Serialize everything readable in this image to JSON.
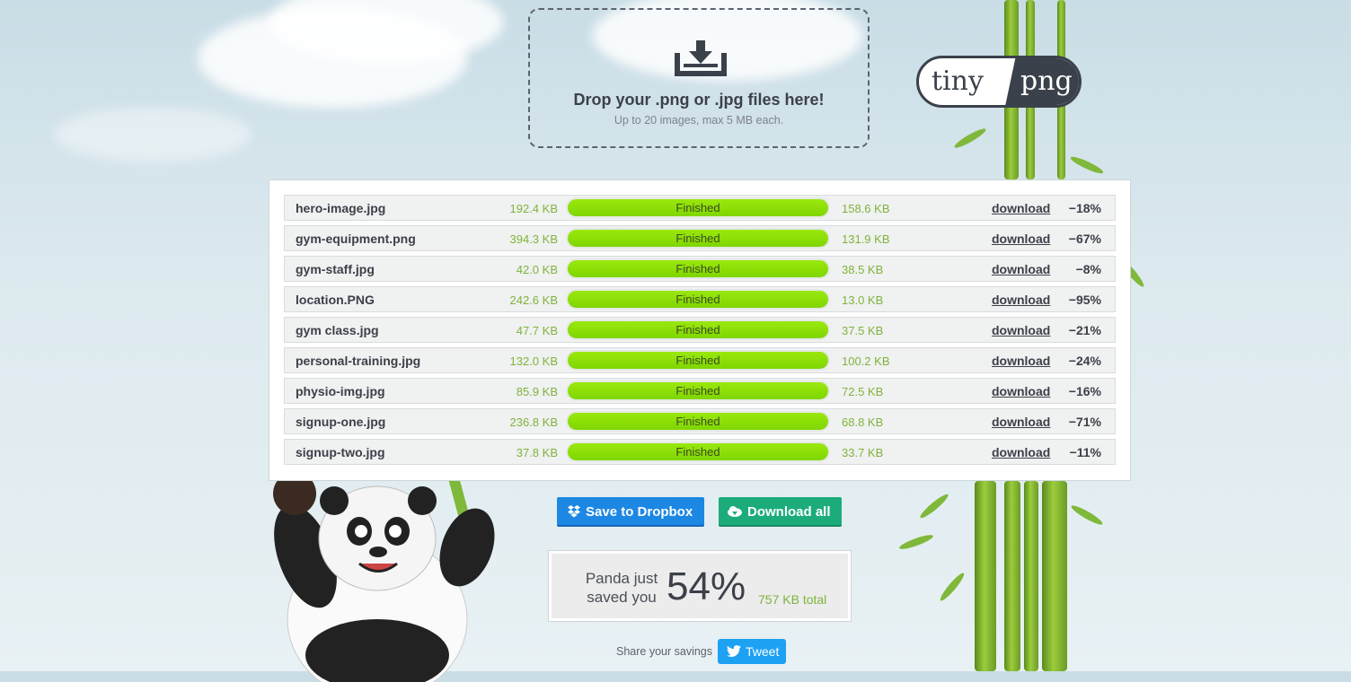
{
  "dropzone": {
    "title": "Drop your .png or .jpg files here!",
    "subtitle": "Up to 20 images, max 5 MB each.",
    "icon": "download-tray-icon"
  },
  "logo": {
    "left": "tiny",
    "right": "png"
  },
  "files": [
    {
      "name": "hero-image.jpg",
      "original": "192.4 KB",
      "status": "Finished",
      "compressed": "158.6 KB",
      "download": "download",
      "saving": "−18%"
    },
    {
      "name": "gym-equipment.png",
      "original": "394.3 KB",
      "status": "Finished",
      "compressed": "131.9 KB",
      "download": "download",
      "saving": "−67%"
    },
    {
      "name": "gym-staff.jpg",
      "original": "42.0 KB",
      "status": "Finished",
      "compressed": "38.5 KB",
      "download": "download",
      "saving": "−8%"
    },
    {
      "name": "location.PNG",
      "original": "242.6 KB",
      "status": "Finished",
      "compressed": "13.0 KB",
      "download": "download",
      "saving": "−95%"
    },
    {
      "name": "gym class.jpg",
      "original": "47.7 KB",
      "status": "Finished",
      "compressed": "37.5 KB",
      "download": "download",
      "saving": "−21%"
    },
    {
      "name": "personal-training.jpg",
      "original": "132.0 KB",
      "status": "Finished",
      "compressed": "100.2 KB",
      "download": "download",
      "saving": "−24%"
    },
    {
      "name": "physio-img.jpg",
      "original": "85.9 KB",
      "status": "Finished",
      "compressed": "72.5 KB",
      "download": "download",
      "saving": "−16%"
    },
    {
      "name": "signup-one.jpg",
      "original": "236.8 KB",
      "status": "Finished",
      "compressed": "68.8 KB",
      "download": "download",
      "saving": "−71%"
    },
    {
      "name": "signup-two.jpg",
      "original": "37.8 KB",
      "status": "Finished",
      "compressed": "33.7 KB",
      "download": "download",
      "saving": "−11%"
    }
  ],
  "progress_fraction": 1.0,
  "actions": {
    "dropbox_label": "Save to Dropbox",
    "download_all_label": "Download all"
  },
  "summary": {
    "line1": "Panda just",
    "line2": "saved you",
    "percent": "54%",
    "total": "757 KB total"
  },
  "share": {
    "text": "Share your savings",
    "tweet_label": "Tweet"
  },
  "colors": {
    "accent_green": "#7fd600",
    "dropbox_blue": "#1d87e4",
    "download_green": "#1cac7c",
    "twitter_blue": "#1da1f2"
  }
}
